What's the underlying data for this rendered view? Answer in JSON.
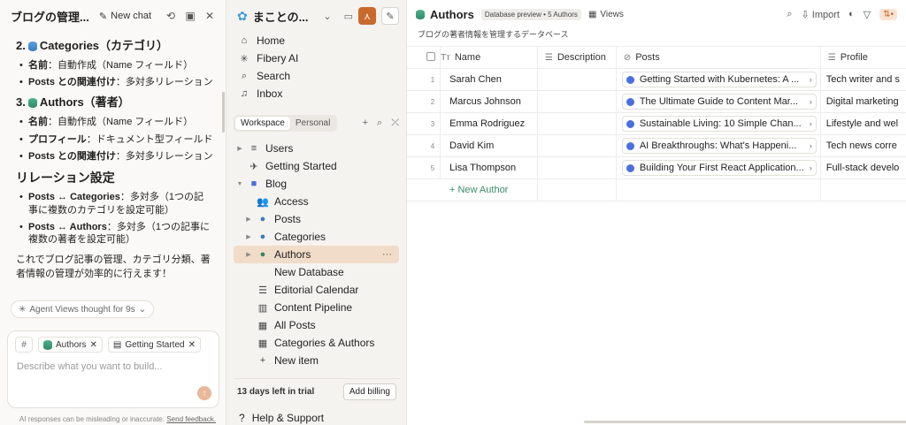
{
  "chat": {
    "title": "ブログの管理...",
    "new_chat": "New chat",
    "sections": [
      {
        "heading": "2.",
        "name": "Categories（カテゴリ）",
        "icon": "blue-db",
        "items": [
          {
            "b": "名前",
            "t": "：自動作成（Name フィールド）"
          },
          {
            "b": "Posts との関連付け",
            "t": "：多対多リレーション"
          }
        ]
      },
      {
        "heading": "3.",
        "name": "Authors（著者）",
        "icon": "green-db",
        "items": [
          {
            "b": "名前",
            "t": "：自動作成（Name フィールド）"
          },
          {
            "b": "プロフィール",
            "t": "：ドキュメント型フィールド"
          },
          {
            "b": "Posts との関連付け",
            "t": "：多対多リレーション"
          }
        ]
      }
    ],
    "relations_heading": "リレーション設定",
    "relations": [
      {
        "b": "Posts ↔ Categories",
        "t": "：多対多（1つの記事に複数のカテゴリを設定可能）"
      },
      {
        "b": "Posts ↔ Authors",
        "t": "：多対多（1つの記事に複数の著者を設定可能）"
      }
    ],
    "closing": "これでブログ記事の管理、カテゴリ分類、著者情報の管理が効率的に行えます！",
    "thought": "Agent Views thought for 9s",
    "chips": [
      "Authors",
      "Getting Started"
    ],
    "input_placeholder": "Describe what you want to build...",
    "disclaimer": "AI responses can be misleading or inaccurate.",
    "feedback": "Send feedback."
  },
  "sidebar": {
    "workspace": "まことの...",
    "nav": [
      {
        "label": "Home",
        "icon": "home-icon",
        "glyph": "⌂"
      },
      {
        "label": "Fibery AI",
        "icon": "ai-icon",
        "glyph": "✳"
      },
      {
        "label": "Search",
        "icon": "search-icon",
        "glyph": "⌕"
      },
      {
        "label": "Inbox",
        "icon": "bell-icon",
        "glyph": "♫"
      }
    ],
    "tabs": [
      "Workspace",
      "Personal"
    ],
    "tree": [
      {
        "label": "Users",
        "arrow": "▶",
        "glyph": "≡",
        "indent": 0
      },
      {
        "label": "Getting Started",
        "arrow": "",
        "glyph": "✈",
        "indent": 0
      },
      {
        "label": "Blog",
        "arrow": "▼",
        "glyph": "■",
        "indent": 0
      },
      {
        "label": "Access",
        "arrow": "",
        "glyph": "👥",
        "indent": 1
      },
      {
        "label": "Posts",
        "arrow": "▶",
        "glyph": "●",
        "indent": 1
      },
      {
        "label": "Categories",
        "arrow": "▶",
        "glyph": "●",
        "indent": 1
      },
      {
        "label": "Authors",
        "arrow": "▶",
        "glyph": "●",
        "indent": 1,
        "active": true
      },
      {
        "label": "New Database",
        "arrow": "",
        "glyph": "",
        "indent": 1
      },
      {
        "label": "Editorial Calendar",
        "arrow": "",
        "glyph": "☰",
        "indent": 1
      },
      {
        "label": "Content Pipeline",
        "arrow": "",
        "glyph": "▥",
        "indent": 1
      },
      {
        "label": "All Posts",
        "arrow": "",
        "glyph": "▦",
        "indent": 1
      },
      {
        "label": "Categories & Authors",
        "arrow": "",
        "glyph": "▦",
        "indent": 1
      },
      {
        "label": "New item",
        "arrow": "",
        "glyph": "+",
        "indent": 1
      }
    ],
    "trial_text": "13 days left in trial",
    "add_billing": "Add billing",
    "help": "Help & Support"
  },
  "main": {
    "title": "Authors",
    "badge": "Database preview • 5 Authors",
    "views": "Views",
    "import": "Import",
    "subtitle": "ブログの著者情報を管理するデータベース",
    "columns": [
      "Name",
      "Description",
      "Posts",
      "Profile"
    ],
    "rows": [
      {
        "n": "1",
        "name": "Sarah Chen",
        "post": "Getting Started with Kubernetes: A ...",
        "profile": "Tech writer and s"
      },
      {
        "n": "2",
        "name": "Marcus Johnson",
        "post": "The Ultimate Guide to Content Mar...",
        "profile": "Digital marketing"
      },
      {
        "n": "3",
        "name": "Emma Rodriguez",
        "post": "Sustainable Living: 10 Simple Chan...",
        "profile": "Lifestyle and wel"
      },
      {
        "n": "4",
        "name": "David Kim",
        "post": "AI Breakthroughs: What's Happeni...",
        "profile": "Tech news corre"
      },
      {
        "n": "5",
        "name": "Lisa Thompson",
        "post": "Building Your First React Application...",
        "profile": "Full-stack develo"
      }
    ],
    "new_author": "+ New Author"
  }
}
